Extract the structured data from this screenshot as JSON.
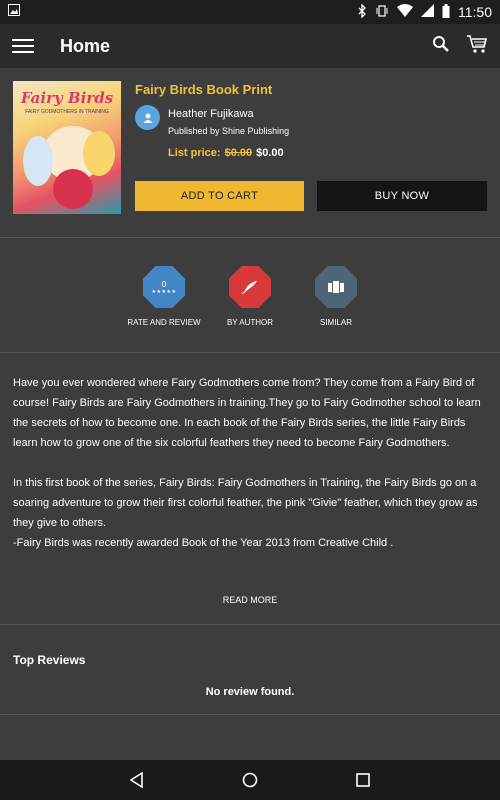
{
  "status_bar": {
    "time": "11:50",
    "icons": [
      "image-icon",
      "bluetooth-icon",
      "wifi-icon",
      "battery-icon"
    ]
  },
  "app_bar": {
    "title": "Home",
    "icons": [
      "menu-icon",
      "search-icon",
      "cart-icon"
    ]
  },
  "product": {
    "cover_title": "Fairy Birds",
    "cover_subtitle": "FAIRY GODMOTHERS IN TRAINING",
    "title": "Fairy Birds Book Print",
    "author": "Heather Fujikawa",
    "publisher": "Published by Shine Publishing",
    "price_label": "List price:",
    "old_price": "$0.00",
    "new_price": "$0.00",
    "add_to_cart": "ADD TO CART",
    "buy_now": "BUY NOW"
  },
  "actions": {
    "rate": {
      "label": "RATE AND REVIEW",
      "count": "0",
      "stars": "★★★★★"
    },
    "author": {
      "label": "BY AUTHOR"
    },
    "similar": {
      "label": "SIMILAR"
    }
  },
  "description": {
    "p1": "Have you ever wondered where Fairy Godmothers come from? They come from a Fairy Bird of course! Fairy Birds are Fairy Godmothers in training.They go to Fairy Godmother school to learn the secrets of how to become one. In each book of the Fairy Birds series, the little Fairy Birds learn how to grow one of the six colorful feathers they need to become Fairy Godmothers.",
    "p2": "In this first book of the series, Fairy Birds: Fairy Godmothers in Training, the Fairy Birds go on a soaring adventure to grow their first colorful feather, the pink \"Givie\" feather, which they grow as they give to others.",
    "p3": "-Fairy Birds was recently awarded Book of the Year 2013 from Creative Child .",
    "read_more": "READ MORE"
  },
  "reviews": {
    "heading": "Top Reviews",
    "empty": "No review found."
  },
  "colors": {
    "accent": "#f0c23a",
    "button_primary": "#f0b731",
    "badge_blue": "#4386c6",
    "badge_red": "#d83a3c",
    "badge_slate": "#4f6676",
    "background": "#3d3d3d"
  }
}
